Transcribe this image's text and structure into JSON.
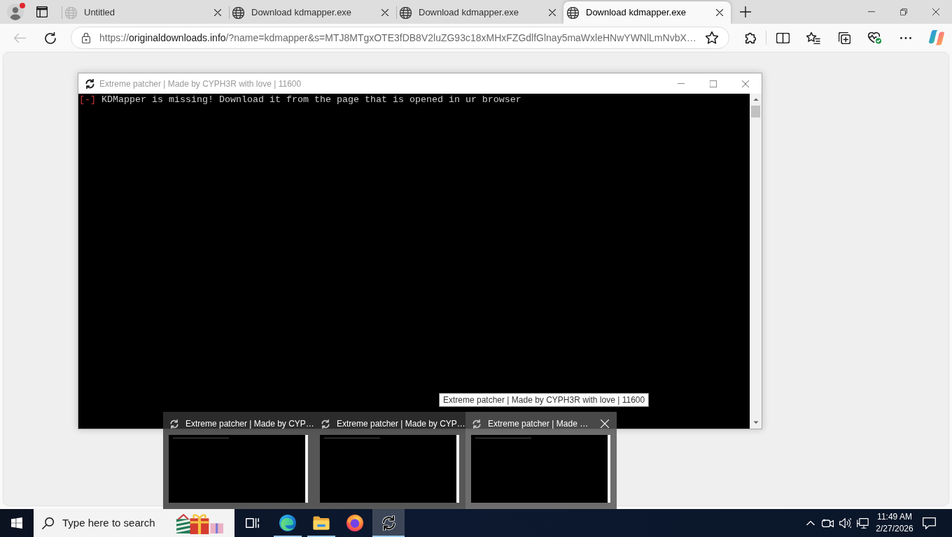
{
  "browser": {
    "tabs": [
      {
        "title": "Untitled",
        "selected": false,
        "dimmed": true
      },
      {
        "title": "Download kdmapper.exe",
        "selected": false,
        "dimmed": false
      },
      {
        "title": "Download kdmapper.exe",
        "selected": false,
        "dimmed": false
      },
      {
        "title": "Download kdmapper.exe",
        "selected": true,
        "dimmed": false
      }
    ],
    "back_button": {
      "disabled": true
    },
    "address": {
      "scheme": "https://",
      "host": "originaldownloads.info",
      "rest": "/?name=kdmapper&s=MTJ8MTgxOTE3fDB8V2luZG93c18xMHxFZGdlfGlnay5maWxleHNwYWNlLmNvbX…"
    }
  },
  "console_window": {
    "title": "Extreme patcher | Made by CYPH3R with love | 11600",
    "active": false,
    "lines": [
      {
        "kind": "error",
        "marker": "[-]",
        "text": "KDMapper is missing! Download it from the page that is opened in ur browser"
      }
    ]
  },
  "tooltip": {
    "text": "Extreme patcher | Made by CYPH3R with love | 11600"
  },
  "thumbnails": [
    {
      "title": "Extreme patcher | Made by CYP…",
      "selected": false
    },
    {
      "title": "Extreme patcher | Made by CYP…",
      "selected": false
    },
    {
      "title": "Extreme patcher | Made …",
      "selected": true
    }
  ],
  "taskbar": {
    "search": {
      "placeholder": "Type here to search"
    },
    "apps": [
      {
        "kind": "edge",
        "running": true,
        "active": false
      },
      {
        "kind": "explorer",
        "running": true,
        "active": false
      },
      {
        "kind": "firefox",
        "running": false,
        "active": false
      },
      {
        "kind": "patcher",
        "running": true,
        "active": true
      }
    ],
    "clock": {
      "time": "11:49 AM",
      "date": "2/27/2026"
    }
  }
}
